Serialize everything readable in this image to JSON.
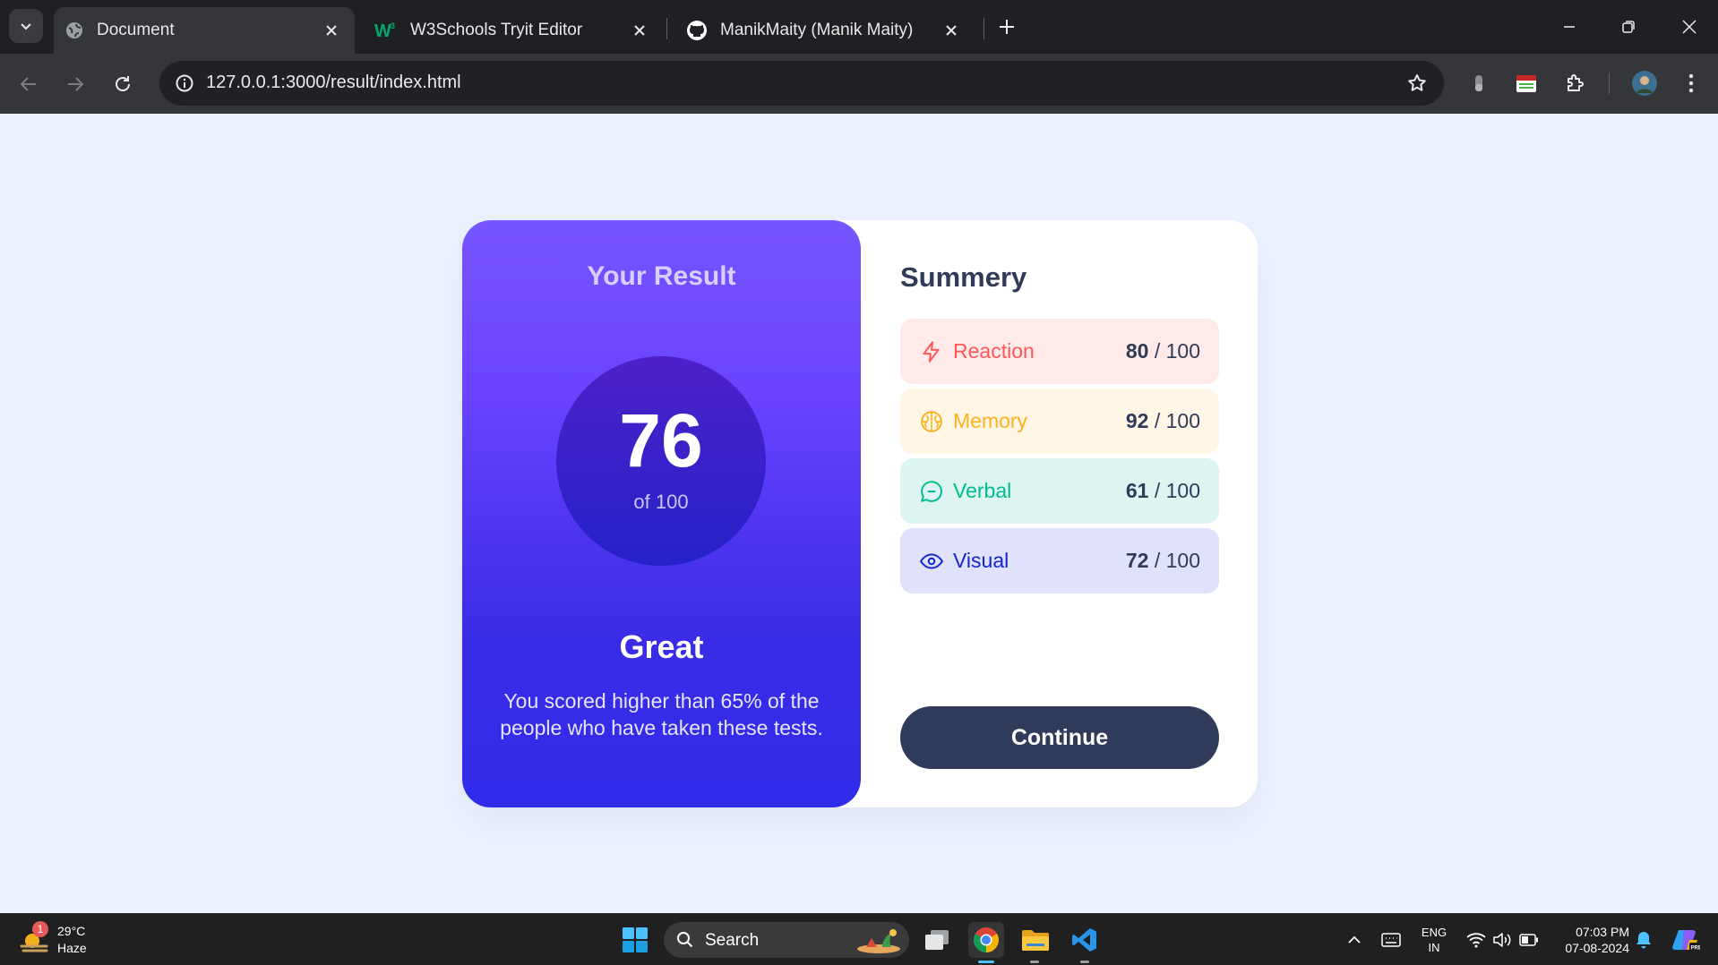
{
  "browser": {
    "tabs": [
      {
        "title": "Document",
        "active": true,
        "icon": "globe-icon"
      },
      {
        "title": "W3Schools Tryit Editor",
        "active": false,
        "icon": "w3schools-icon"
      },
      {
        "title": "ManikMaity (Manik Maity)",
        "active": false,
        "icon": "github-icon"
      }
    ],
    "url": "127.0.0.1:3000/result/index.html"
  },
  "result": {
    "title": "Your Result",
    "score": "76",
    "score_of": "of 100",
    "grade": "Great",
    "description": "You scored higher than 65% of the people who have taken these tests."
  },
  "summary": {
    "title": "Summery",
    "items": [
      {
        "label": "Reaction",
        "score": "80",
        "max": "/ 100",
        "icon": "lightning-icon",
        "color": "#ff5757",
        "bg": "#ffe9e9"
      },
      {
        "label": "Memory",
        "score": "92",
        "max": "/ 100",
        "icon": "brain-icon",
        "color": "#ffb01f",
        "bg": "#fff6e6"
      },
      {
        "label": "Verbal",
        "score": "61",
        "max": "/ 100",
        "icon": "chat-icon",
        "color": "#00bb8f",
        "bg": "#dcf5f0"
      },
      {
        "label": "Visual",
        "score": "72",
        "max": "/ 100",
        "icon": "eye-icon",
        "color": "#1125d6",
        "bg": "#e0e1fa"
      }
    ],
    "continue_label": "Continue"
  },
  "taskbar": {
    "weather_temp": "29°C",
    "weather_desc": "Haze",
    "weather_badge": "1",
    "search_label": "Search",
    "lang_line1": "ENG",
    "lang_line2": "IN",
    "time": "07:03 PM",
    "date": "07-08-2024"
  }
}
